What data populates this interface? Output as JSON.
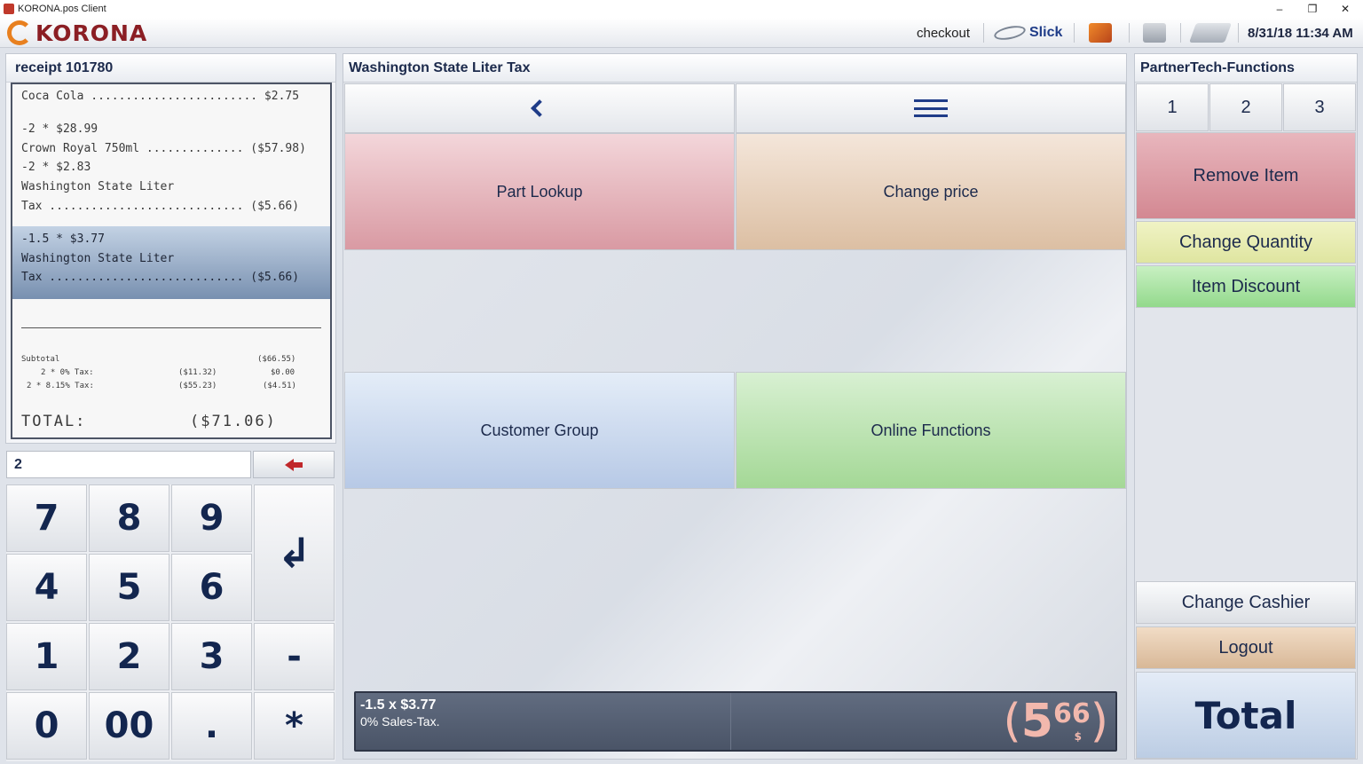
{
  "window": {
    "title": "KORONA.pos Client",
    "controls": {
      "minimize": "–",
      "restore": "❐",
      "close": "✕"
    }
  },
  "header": {
    "logo_text": "KORONA",
    "mode": "checkout",
    "slick": "Slick",
    "datetime": "8/31/18 11:34 AM"
  },
  "receipt": {
    "title": "receipt 101780",
    "lines": [
      "Coca Cola ........................ $2.75",
      "-2 * $28.99",
      "Crown Royal 750ml .............. ($57.98)",
      "-2 * $2.83",
      "Washington State Liter",
      "Tax ............................ ($5.66)"
    ],
    "selected_lines": [
      "-1.5 * $3.77",
      "Washington State Liter",
      "Tax ............................ ($5.66)"
    ],
    "subtotal_label": "Subtotal",
    "subtotal_value": "($66.55)",
    "tax1_label": "2 * 0% Tax:",
    "tax1_base": "($11.32)",
    "tax1_value": "$0.00",
    "tax2_label": "2 * 8.15% Tax:",
    "tax2_base": "($55.23)",
    "tax2_value": "($4.51)",
    "total_label": "TOTAL:",
    "total_value": "($71.06)"
  },
  "entry": {
    "value": "2"
  },
  "keypad": {
    "k7": "7",
    "k8": "8",
    "k9": "9",
    "k4": "4",
    "k5": "5",
    "k6": "6",
    "k1": "1",
    "k2": "2",
    "k3": "3",
    "kminus": "-",
    "k0": "0",
    "k00": "00",
    "kdot": ".",
    "kstar": "*",
    "enter": "↲"
  },
  "center": {
    "title": "Washington State Liter Tax",
    "buttons": {
      "part_lookup": "Part Lookup",
      "change_price": "Change price",
      "customer_group": "Customer Group",
      "online_functions": "Online Functions"
    },
    "status": {
      "line1": "-1.5 x $3.77",
      "line2": "0% Sales-Tax.",
      "paren_open": "(",
      "price_int": "5",
      "price_dec": "66",
      "paren_close": ")",
      "currency": "$"
    }
  },
  "right": {
    "title": "PartnerTech-Functions",
    "tabs": [
      "1",
      "2",
      "3"
    ],
    "remove_item": "Remove Item",
    "change_quantity": "Change Quantity",
    "item_discount": "Item Discount",
    "change_cashier": "Change Cashier",
    "logout": "Logout",
    "total": "Total"
  },
  "colors": {
    "brand": "#8b1e24",
    "accent": "#1f3c88"
  }
}
